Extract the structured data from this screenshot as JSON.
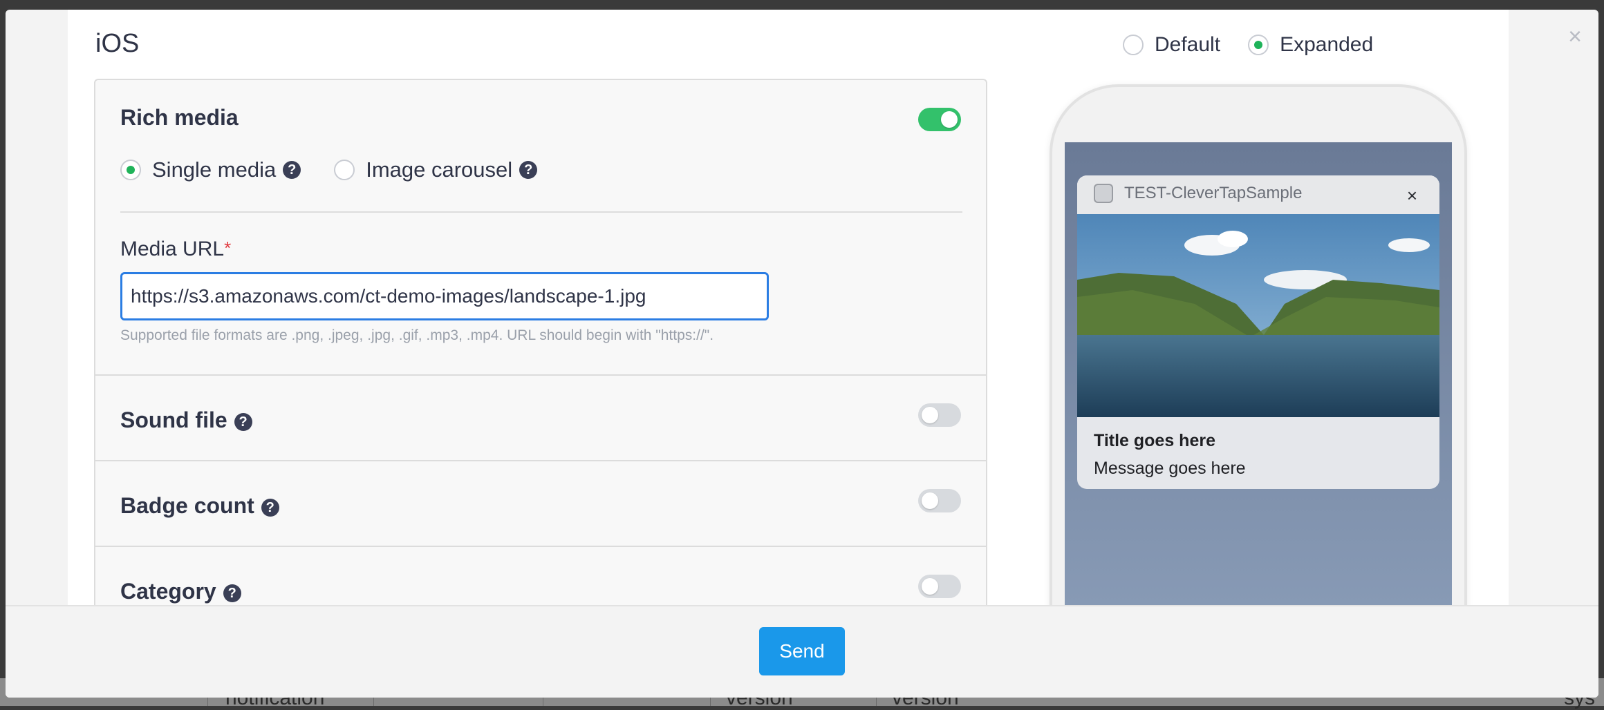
{
  "background": {
    "cells": [
      "notification",
      "version",
      "version",
      "sys"
    ]
  },
  "modal": {
    "platform_title": "iOS",
    "view_options": [
      {
        "label": "Default",
        "selected": false
      },
      {
        "label": "Expanded",
        "selected": true
      }
    ],
    "rich_media": {
      "title": "Rich media",
      "enabled": true,
      "media_types": [
        {
          "label": "Single media",
          "selected": true
        },
        {
          "label": "Image carousel",
          "selected": false
        }
      ],
      "media_url_label": "Media URL",
      "required_mark": "*",
      "media_url_value": "https://s3.amazonaws.com/ct-demo-images/landscape-1.jpg",
      "hint": "Supported file formats are .png, .jpeg, .jpg, .gif, .mp3, .mp4. URL should begin with \"https://\"."
    },
    "sound_file": {
      "title": "Sound file",
      "enabled": false
    },
    "badge_count": {
      "title": "Badge count",
      "enabled": false
    },
    "category": {
      "title": "Category",
      "enabled": false
    },
    "help_glyph": "?",
    "close_glyph": "×"
  },
  "preview": {
    "app_name": "TEST-CleverTapSample",
    "close_glyph": "×",
    "title": "Title goes here",
    "message": "Message goes here",
    "image_icon": "landscape-image"
  },
  "footer": {
    "send_label": "Send"
  },
  "colors": {
    "accent_green": "#1fb35a",
    "toggle_on": "#33c16b",
    "primary_blue": "#1a98ea",
    "input_focus": "#2b7de3"
  }
}
